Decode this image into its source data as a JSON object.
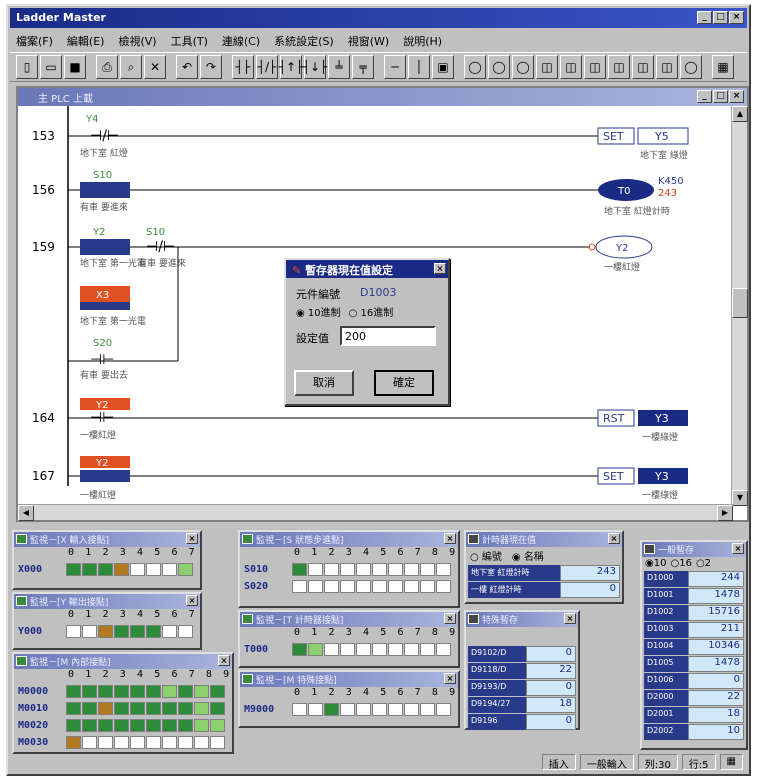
{
  "app": {
    "title": "Ladder Master"
  },
  "menu": [
    "檔案(F)",
    "編輯(E)",
    "檢視(V)",
    "工具(T)",
    "連線(C)",
    "系統設定(S)",
    "視窗(W)",
    "說明(H)"
  ],
  "child": {
    "title": "主 PLC  上載"
  },
  "rungs": [
    {
      "num": "153",
      "contact": "Y4",
      "contact_desc": "地下室 紅燈",
      "coil_type": "SET",
      "coil": "Y5",
      "coil_desc": "地下室 綠燈"
    },
    {
      "num": "156",
      "contact": "S10",
      "contact_desc": "有車 要進來",
      "coil_type": "T",
      "coil": "T0",
      "coil_param": "K450",
      "coil_value": "243",
      "coil_desc": "地下室 紅燈計時"
    },
    {
      "num": "159",
      "contact": "Y2",
      "contact_desc": "地下室 第一光電",
      "contact2": "S10",
      "contact2_desc": "有車 要進來",
      "contact3": "X3",
      "contact3_desc": "地下室 第一光電",
      "contact4": "S20",
      "contact4_desc": "有車 要出去",
      "coil": "Y2",
      "coil_desc": "一樓紅燈"
    },
    {
      "num": "164",
      "contact": "Y2",
      "contact_desc": "一樓紅燈",
      "coil_type": "RST",
      "coil": "Y3",
      "coil_desc": "一樓綠燈"
    },
    {
      "num": "167",
      "contact": "Y2",
      "contact_desc": "一樓紅燈",
      "coil_type": "SET",
      "coil": "Y3",
      "coil_desc": "一樓綠燈"
    }
  ],
  "dialog": {
    "title": "暫存器現在值設定",
    "element_label": "元件編號",
    "element_value": "D1003",
    "radio_dec": "10進制",
    "radio_hex": "16進制",
    "setvalue_label": "設定值",
    "setvalue": "200",
    "cancel": "取消",
    "ok": "確定"
  },
  "monitors": {
    "x": {
      "title": "監視－[X 輸入接點]",
      "header": "0 1 2 3 4 5 6 7",
      "rows": [
        {
          "label": "X000",
          "cells": [
            "on",
            "on",
            "on",
            "orn",
            "",
            "",
            "",
            "lon"
          ]
        }
      ]
    },
    "y": {
      "title": "監視－[Y 輸出接點]",
      "header": "0 1 2 3 4 5 6 7",
      "rows": [
        {
          "label": "Y000",
          "cells": [
            "",
            "",
            "orn",
            "on",
            "on",
            "on",
            "",
            ""
          ]
        }
      ]
    },
    "m": {
      "title": "監視－[M 內部接點]",
      "header": "0 1 2 3 4 5 6 7 8 9",
      "rows": [
        {
          "label": "M0000",
          "cells": [
            "on",
            "on",
            "on",
            "on",
            "on",
            "on",
            "lon",
            "on",
            "lon",
            "on"
          ]
        },
        {
          "label": "M0010",
          "cells": [
            "on",
            "on",
            "orn",
            "on",
            "on",
            "on",
            "on",
            "on",
            "lon",
            "on"
          ]
        },
        {
          "label": "M0020",
          "cells": [
            "on",
            "on",
            "on",
            "on",
            "on",
            "on",
            "on",
            "on",
            "lon",
            "lon"
          ]
        },
        {
          "label": "M0030",
          "cells": [
            "orn",
            "",
            "",
            "",
            "",
            "",
            "",
            "",
            "",
            ""
          ]
        }
      ]
    },
    "s": {
      "title": "監視－[S 狀態步進點]",
      "header": "0 1 2 3 4 5 6 7 8 9",
      "rows": [
        {
          "label": "S010",
          "cells": [
            "on",
            "",
            "",
            "",
            "",
            "",
            "",
            "",
            "",
            ""
          ]
        },
        {
          "label": "S020",
          "cells": [
            "",
            "",
            "",
            "",
            "",
            "",
            "",
            "",
            "",
            ""
          ]
        }
      ]
    },
    "t": {
      "title": "監視－[T 計時器接點]",
      "header": "0 1 2 3 4 5 6 7 8 9",
      "rows": [
        {
          "label": "T000",
          "cells": [
            "on",
            "lon",
            "",
            "",
            "",
            "",
            "",
            "",
            "",
            ""
          ]
        }
      ]
    },
    "sm": {
      "title": "監視－[M 特殊接點]",
      "header": "0 1 2 3 4 5 6 7 8 9",
      "rows": [
        {
          "label": "M9000",
          "cells": [
            "",
            "",
            "on",
            "",
            "",
            "",
            "",
            "",
            "",
            ""
          ]
        }
      ]
    }
  },
  "timer_panel": {
    "title": "計時器現在值",
    "radio1": "編號",
    "radio2": "名稱",
    "rows": [
      {
        "name": "地下室 紅燈計時",
        "value": "243"
      },
      {
        "name": "一樓 紅燈計時",
        "value": "0"
      }
    ]
  },
  "special_panel": {
    "title": "特殊暫存",
    "rows": [
      {
        "name": "D9102/D",
        "value": "0"
      },
      {
        "name": "D9118/D",
        "value": "22"
      },
      {
        "name": "D9193/D",
        "value": "0"
      },
      {
        "name": "D9194/27",
        "value": "18"
      },
      {
        "name": "D9196",
        "value": "0"
      }
    ]
  },
  "register_panel": {
    "title": "一般暫存",
    "radio_a": "10",
    "radio_b": "16",
    "radio_c": "2",
    "rows": [
      {
        "name": "D1000",
        "value": "244"
      },
      {
        "name": "D1001",
        "value": "1478"
      },
      {
        "name": "D1002",
        "value": "15716"
      },
      {
        "name": "D1003",
        "value": "211"
      },
      {
        "name": "D1004",
        "value": "10346"
      },
      {
        "name": "D1005",
        "value": "1478"
      },
      {
        "name": "D1006",
        "value": "0"
      },
      {
        "name": "D2000",
        "value": "22"
      },
      {
        "name": "D2001",
        "value": "18"
      },
      {
        "name": "D2002",
        "value": "10"
      }
    ]
  },
  "status": {
    "insert": "插入",
    "mode": "一般輸入",
    "col": "列:30",
    "row": "行:5",
    "icon": "ladder-icon"
  }
}
